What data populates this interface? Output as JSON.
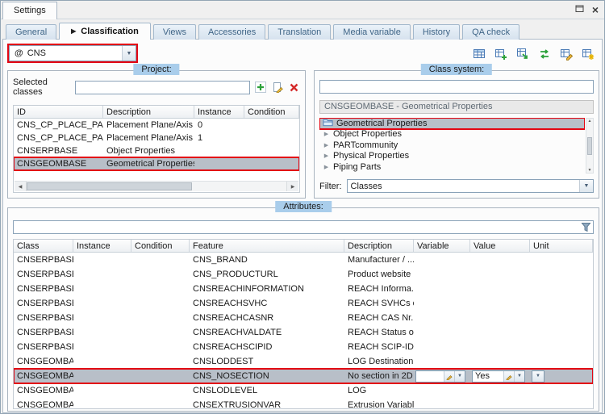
{
  "window": {
    "title": "Settings"
  },
  "tabs": [
    {
      "label": "General"
    },
    {
      "label": "Classification",
      "active": true
    },
    {
      "label": "Views"
    },
    {
      "label": "Accessories"
    },
    {
      "label": "Translation"
    },
    {
      "label": "Media variable"
    },
    {
      "label": "History"
    },
    {
      "label": "QA check"
    }
  ],
  "catalog_selector": {
    "prefix": "@",
    "value": "CNS"
  },
  "toolbar_icons": [
    "table-icon",
    "add-table-icon",
    "import-table-icon",
    "sync-table-icon",
    "edit-table-icon",
    "report-table-icon"
  ],
  "project": {
    "legend": "Project:",
    "selected_classes_label": "Selected classes",
    "selected_classes_value": "",
    "columns": [
      "ID",
      "Description",
      "Instance",
      "Condition"
    ],
    "rows": [
      {
        "id": "CNS_CP_PLACE_PA",
        "description": "Placement Plane/Axis",
        "instance": "0",
        "condition": ""
      },
      {
        "id": "CNS_CP_PLACE_PA",
        "description": "Placement Plane/Axis",
        "instance": "1",
        "condition": ""
      },
      {
        "id": "CNSERPBASE",
        "description": "Object Properties",
        "instance": "",
        "condition": ""
      },
      {
        "id": "CNSGEOMBASE",
        "description": "Geometrical Properties",
        "instance": "",
        "condition": "",
        "selected": true
      }
    ]
  },
  "class_system": {
    "legend": "Class system:",
    "search_value": "",
    "selected_path": "CNSGEOMBASE - Geometrical Properties",
    "tree": [
      {
        "label": "Geometrical Properties",
        "selected": true
      },
      {
        "label": "Object Properties"
      },
      {
        "label": "PARTcommunity"
      },
      {
        "label": "Physical Properties"
      },
      {
        "label": "Piping Parts"
      }
    ],
    "filter_label": "Filter:",
    "filter_value": "Classes"
  },
  "attributes": {
    "legend": "Attributes:",
    "filter_value": "",
    "columns": [
      "Class",
      "Instance",
      "Condition",
      "Feature",
      "Description",
      "Variable",
      "Value",
      "Unit"
    ],
    "rows": [
      {
        "class": "CNSERPBASE",
        "instance": "",
        "condition": "",
        "feature": "CNS_BRAND",
        "description": "Manufacturer / ...",
        "variable": "",
        "value": "",
        "unit": ""
      },
      {
        "class": "CNSERPBASE",
        "instance": "",
        "condition": "",
        "feature": "CNS_PRODUCTURL",
        "description": "Product website",
        "variable": "",
        "value": "",
        "unit": ""
      },
      {
        "class": "CNSERPBASE",
        "instance": "",
        "condition": "",
        "feature": "CNSREACHINFORMATION",
        "description": "REACH Informa...",
        "variable": "",
        "value": "",
        "unit": ""
      },
      {
        "class": "CNSERPBASE",
        "instance": "",
        "condition": "",
        "feature": "CNSREACHSVHC",
        "description": "REACH SVHCs o...",
        "variable": "",
        "value": "",
        "unit": ""
      },
      {
        "class": "CNSERPBASE",
        "instance": "",
        "condition": "",
        "feature": "CNSREACHCASNR",
        "description": "REACH CAS Nr.",
        "variable": "",
        "value": "",
        "unit": ""
      },
      {
        "class": "CNSERPBASE",
        "instance": "",
        "condition": "",
        "feature": "CNSREACHVALDATE",
        "description": "REACH Status o...",
        "variable": "",
        "value": "",
        "unit": ""
      },
      {
        "class": "CNSERPBASE",
        "instance": "",
        "condition": "",
        "feature": "CNSREACHSCIPID",
        "description": "REACH SCIP-ID",
        "variable": "",
        "value": "",
        "unit": ""
      },
      {
        "class": "CNSGEOMBASE",
        "instance": "",
        "condition": "",
        "feature": "CNSLODDEST",
        "description": "LOG Destination",
        "variable": "",
        "value": "",
        "unit": ""
      },
      {
        "class": "CNSGEOMBASE",
        "instance": "",
        "condition": "",
        "feature": "CNS_NOSECTION",
        "description": "No section in 2D",
        "variable": "",
        "value": "Yes",
        "unit": "",
        "selected": true
      },
      {
        "class": "CNSGEOMBASE",
        "instance": "",
        "condition": "",
        "feature": "CNSLODLEVEL",
        "description": "LOG",
        "variable": "",
        "value": "",
        "unit": ""
      },
      {
        "class": "CNSGEOMBASE",
        "instance": "",
        "condition": "",
        "feature": "CNSEXTRUSIONVAR",
        "description": "Extrusion Variable",
        "variable": "",
        "value": "",
        "unit": ""
      }
    ]
  },
  "colors": {
    "annotation_red": "#e30613",
    "selection_gray": "#b8bfc8",
    "legend_blue": "#a9cdeb"
  }
}
